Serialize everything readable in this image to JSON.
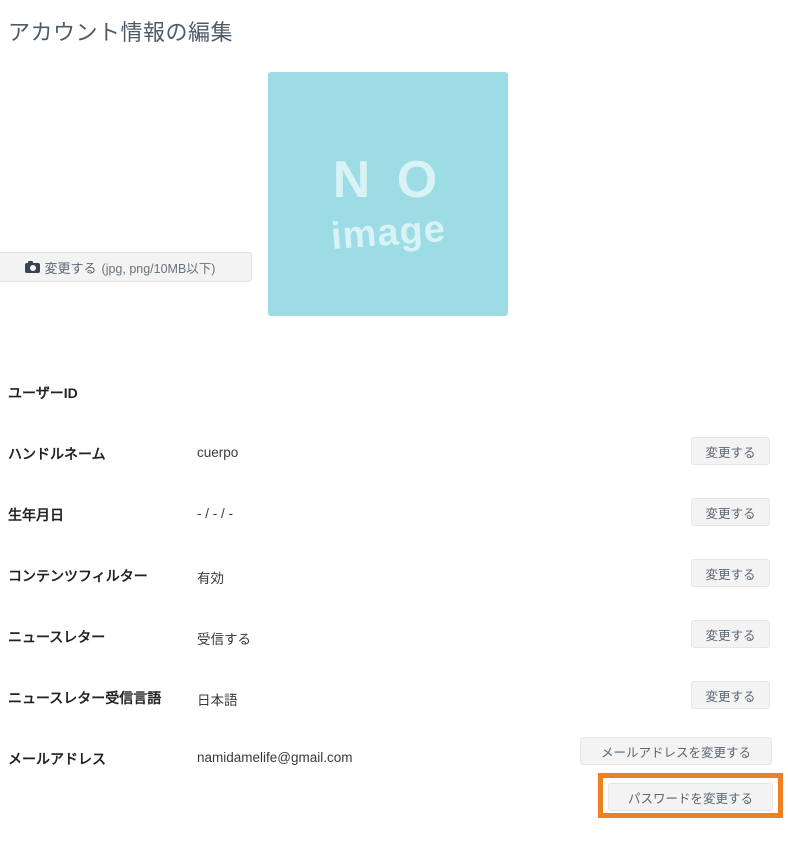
{
  "page": {
    "title": "アカウント情報の編集"
  },
  "avatar": {
    "placeholder_line1": "N O",
    "placeholder_line2": "image",
    "background_color": "#9cdce4",
    "change_button": {
      "icon": "camera-icon",
      "label": "変更する",
      "hint": "(jpg, png/10MB以下)"
    }
  },
  "fields": [
    {
      "label": "ユーザーID",
      "value": "",
      "has_button": false,
      "button_label": ""
    },
    {
      "label": "ハンドルネーム",
      "value": "cuerpo",
      "has_button": true,
      "button_label": "変更する"
    },
    {
      "label": "生年月日",
      "value": "- / - / -",
      "has_button": true,
      "button_label": "変更する"
    },
    {
      "label": "コンテンツフィルター",
      "value": "有効",
      "has_button": true,
      "button_label": "変更する"
    },
    {
      "label": "ニュースレター",
      "value": "受信する",
      "has_button": true,
      "button_label": "変更する"
    },
    {
      "label": "ニュースレター受信言語",
      "value": "日本語",
      "has_button": true,
      "button_label": "変更する"
    },
    {
      "label": "メールアドレス",
      "value": "namidamelife@gmail.com",
      "has_button": false,
      "button_label": ""
    }
  ],
  "actions": {
    "change_email_label": "メールアドレスを変更する",
    "change_password_label": "パスワードを変更する",
    "highlight_color": "#ef8022"
  }
}
